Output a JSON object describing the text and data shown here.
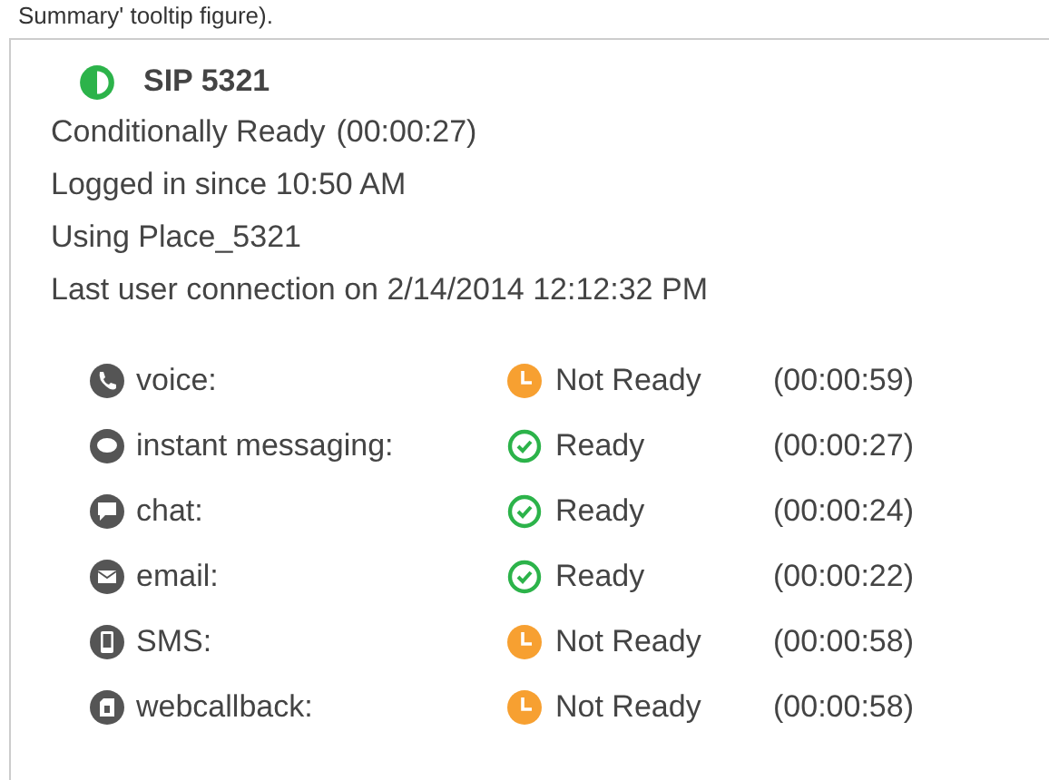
{
  "caption": "Summary' tooltip figure).",
  "agent": {
    "name": "SIP 5321",
    "status": "Conditionally Ready",
    "duration": "(00:00:27)",
    "lines": [
      "Logged in since 10:50 AM",
      "Using Place_5321",
      "Last user connection on 2/14/2014 12:12:32 PM"
    ]
  },
  "channels": [
    {
      "kind": "phone",
      "name": "voice:",
      "ready": false,
      "status": "Not Ready",
      "duration": "(00:00:59)"
    },
    {
      "kind": "bubble",
      "name": "instant messaging:",
      "ready": true,
      "status": "Ready",
      "duration": "(00:00:27)"
    },
    {
      "kind": "chat",
      "name": "chat:",
      "ready": true,
      "status": "Ready",
      "duration": "(00:00:24)"
    },
    {
      "kind": "mail",
      "name": "email:",
      "ready": true,
      "status": "Ready",
      "duration": "(00:00:22)"
    },
    {
      "kind": "mobile",
      "name": "SMS:",
      "ready": false,
      "status": "Not Ready",
      "duration": "(00:00:58)"
    },
    {
      "kind": "doc",
      "name": "webcallback:",
      "ready": false,
      "status": "Not Ready",
      "duration": "(00:00:58)"
    }
  ]
}
